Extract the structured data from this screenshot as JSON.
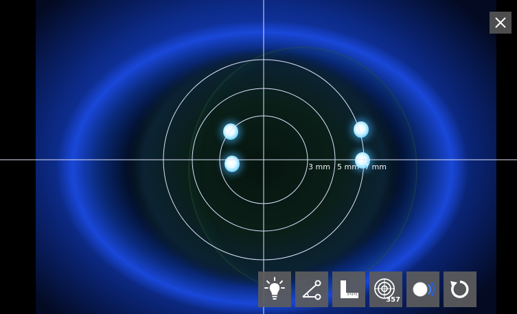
{
  "window": {
    "close_icon": "close-icon"
  },
  "overlay": {
    "rings": [
      {
        "label": "3 mm"
      },
      {
        "label": "5 mm"
      },
      {
        "label": "7 mm"
      }
    ],
    "line_color": "#dfe3ff",
    "reflection_color": "#9fe6ff"
  },
  "toolbar": {
    "buttons": [
      {
        "name": "illumination-button",
        "icon": "lightbulb-icon"
      },
      {
        "name": "angle-measure-button",
        "icon": "angle-measure-icon"
      },
      {
        "name": "ruler-button",
        "icon": "ruler-icon"
      },
      {
        "name": "target-rings-button",
        "icon": "target-rings-icon",
        "counter": "357"
      },
      {
        "name": "eye-view-button",
        "icon": "eye-view-icon"
      },
      {
        "name": "reset-button",
        "icon": "refresh-icon"
      }
    ],
    "button_color": "#5c5c5c"
  }
}
